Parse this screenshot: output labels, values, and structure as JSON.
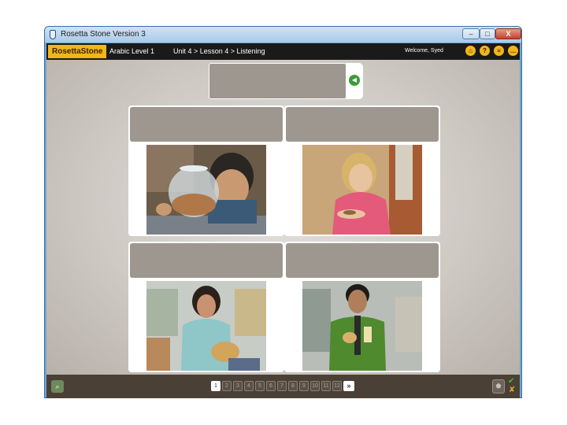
{
  "window": {
    "title": "Rosetta Stone Version 3"
  },
  "window_controls": {
    "minimize": "–",
    "maximize": "□",
    "close": "X"
  },
  "appbar": {
    "logo": "RosettaStone",
    "course": "Arabic Level 1",
    "breadcrumb": "Unit 4 > Lesson 4 > Listening",
    "welcome": "Welcome, Syed",
    "icons": [
      "home-icon",
      "help-icon",
      "menu-icon",
      "chat-icon"
    ]
  },
  "cards": [
    {
      "photo": "boy-with-coin-jar",
      "description_icon": "photo"
    },
    {
      "photo": "woman-counting-coins",
      "description_icon": "photo"
    },
    {
      "photo": "woman-holding-bread",
      "description_icon": "photo"
    },
    {
      "photo": "man-holding-bread",
      "description_icon": "photo"
    }
  ],
  "pager": {
    "pages": [
      "1",
      "2",
      "3",
      "4",
      "5",
      "6",
      "7",
      "8",
      "9",
      "10",
      "11",
      "12"
    ],
    "current": "1",
    "next_label": "»"
  },
  "colors": {
    "accent": "#f2b619",
    "panel": "#9d9790",
    "bar": "#4a4036"
  }
}
